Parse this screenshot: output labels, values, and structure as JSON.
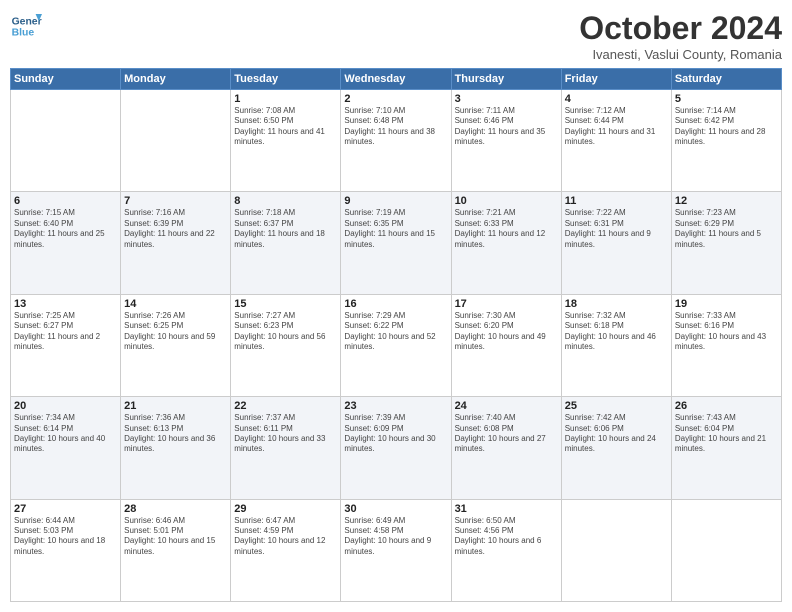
{
  "header": {
    "logo_line1": "General",
    "logo_line2": "Blue",
    "month_title": "October 2024",
    "location": "Ivanesti, Vaslui County, Romania"
  },
  "weekdays": [
    "Sunday",
    "Monday",
    "Tuesday",
    "Wednesday",
    "Thursday",
    "Friday",
    "Saturday"
  ],
  "rows": [
    [
      {
        "day": "",
        "sunrise": "",
        "sunset": "",
        "daylight": ""
      },
      {
        "day": "",
        "sunrise": "",
        "sunset": "",
        "daylight": ""
      },
      {
        "day": "1",
        "sunrise": "Sunrise: 7:08 AM",
        "sunset": "Sunset: 6:50 PM",
        "daylight": "Daylight: 11 hours and 41 minutes."
      },
      {
        "day": "2",
        "sunrise": "Sunrise: 7:10 AM",
        "sunset": "Sunset: 6:48 PM",
        "daylight": "Daylight: 11 hours and 38 minutes."
      },
      {
        "day": "3",
        "sunrise": "Sunrise: 7:11 AM",
        "sunset": "Sunset: 6:46 PM",
        "daylight": "Daylight: 11 hours and 35 minutes."
      },
      {
        "day": "4",
        "sunrise": "Sunrise: 7:12 AM",
        "sunset": "Sunset: 6:44 PM",
        "daylight": "Daylight: 11 hours and 31 minutes."
      },
      {
        "day": "5",
        "sunrise": "Sunrise: 7:14 AM",
        "sunset": "Sunset: 6:42 PM",
        "daylight": "Daylight: 11 hours and 28 minutes."
      }
    ],
    [
      {
        "day": "6",
        "sunrise": "Sunrise: 7:15 AM",
        "sunset": "Sunset: 6:40 PM",
        "daylight": "Daylight: 11 hours and 25 minutes."
      },
      {
        "day": "7",
        "sunrise": "Sunrise: 7:16 AM",
        "sunset": "Sunset: 6:39 PM",
        "daylight": "Daylight: 11 hours and 22 minutes."
      },
      {
        "day": "8",
        "sunrise": "Sunrise: 7:18 AM",
        "sunset": "Sunset: 6:37 PM",
        "daylight": "Daylight: 11 hours and 18 minutes."
      },
      {
        "day": "9",
        "sunrise": "Sunrise: 7:19 AM",
        "sunset": "Sunset: 6:35 PM",
        "daylight": "Daylight: 11 hours and 15 minutes."
      },
      {
        "day": "10",
        "sunrise": "Sunrise: 7:21 AM",
        "sunset": "Sunset: 6:33 PM",
        "daylight": "Daylight: 11 hours and 12 minutes."
      },
      {
        "day": "11",
        "sunrise": "Sunrise: 7:22 AM",
        "sunset": "Sunset: 6:31 PM",
        "daylight": "Daylight: 11 hours and 9 minutes."
      },
      {
        "day": "12",
        "sunrise": "Sunrise: 7:23 AM",
        "sunset": "Sunset: 6:29 PM",
        "daylight": "Daylight: 11 hours and 5 minutes."
      }
    ],
    [
      {
        "day": "13",
        "sunrise": "Sunrise: 7:25 AM",
        "sunset": "Sunset: 6:27 PM",
        "daylight": "Daylight: 11 hours and 2 minutes."
      },
      {
        "day": "14",
        "sunrise": "Sunrise: 7:26 AM",
        "sunset": "Sunset: 6:25 PM",
        "daylight": "Daylight: 10 hours and 59 minutes."
      },
      {
        "day": "15",
        "sunrise": "Sunrise: 7:27 AM",
        "sunset": "Sunset: 6:23 PM",
        "daylight": "Daylight: 10 hours and 56 minutes."
      },
      {
        "day": "16",
        "sunrise": "Sunrise: 7:29 AM",
        "sunset": "Sunset: 6:22 PM",
        "daylight": "Daylight: 10 hours and 52 minutes."
      },
      {
        "day": "17",
        "sunrise": "Sunrise: 7:30 AM",
        "sunset": "Sunset: 6:20 PM",
        "daylight": "Daylight: 10 hours and 49 minutes."
      },
      {
        "day": "18",
        "sunrise": "Sunrise: 7:32 AM",
        "sunset": "Sunset: 6:18 PM",
        "daylight": "Daylight: 10 hours and 46 minutes."
      },
      {
        "day": "19",
        "sunrise": "Sunrise: 7:33 AM",
        "sunset": "Sunset: 6:16 PM",
        "daylight": "Daylight: 10 hours and 43 minutes."
      }
    ],
    [
      {
        "day": "20",
        "sunrise": "Sunrise: 7:34 AM",
        "sunset": "Sunset: 6:14 PM",
        "daylight": "Daylight: 10 hours and 40 minutes."
      },
      {
        "day": "21",
        "sunrise": "Sunrise: 7:36 AM",
        "sunset": "Sunset: 6:13 PM",
        "daylight": "Daylight: 10 hours and 36 minutes."
      },
      {
        "day": "22",
        "sunrise": "Sunrise: 7:37 AM",
        "sunset": "Sunset: 6:11 PM",
        "daylight": "Daylight: 10 hours and 33 minutes."
      },
      {
        "day": "23",
        "sunrise": "Sunrise: 7:39 AM",
        "sunset": "Sunset: 6:09 PM",
        "daylight": "Daylight: 10 hours and 30 minutes."
      },
      {
        "day": "24",
        "sunrise": "Sunrise: 7:40 AM",
        "sunset": "Sunset: 6:08 PM",
        "daylight": "Daylight: 10 hours and 27 minutes."
      },
      {
        "day": "25",
        "sunrise": "Sunrise: 7:42 AM",
        "sunset": "Sunset: 6:06 PM",
        "daylight": "Daylight: 10 hours and 24 minutes."
      },
      {
        "day": "26",
        "sunrise": "Sunrise: 7:43 AM",
        "sunset": "Sunset: 6:04 PM",
        "daylight": "Daylight: 10 hours and 21 minutes."
      }
    ],
    [
      {
        "day": "27",
        "sunrise": "Sunrise: 6:44 AM",
        "sunset": "Sunset: 5:03 PM",
        "daylight": "Daylight: 10 hours and 18 minutes."
      },
      {
        "day": "28",
        "sunrise": "Sunrise: 6:46 AM",
        "sunset": "Sunset: 5:01 PM",
        "daylight": "Daylight: 10 hours and 15 minutes."
      },
      {
        "day": "29",
        "sunrise": "Sunrise: 6:47 AM",
        "sunset": "Sunset: 4:59 PM",
        "daylight": "Daylight: 10 hours and 12 minutes."
      },
      {
        "day": "30",
        "sunrise": "Sunrise: 6:49 AM",
        "sunset": "Sunset: 4:58 PM",
        "daylight": "Daylight: 10 hours and 9 minutes."
      },
      {
        "day": "31",
        "sunrise": "Sunrise: 6:50 AM",
        "sunset": "Sunset: 4:56 PM",
        "daylight": "Daylight: 10 hours and 6 minutes."
      },
      {
        "day": "",
        "sunrise": "",
        "sunset": "",
        "daylight": ""
      },
      {
        "day": "",
        "sunrise": "",
        "sunset": "",
        "daylight": ""
      }
    ]
  ]
}
